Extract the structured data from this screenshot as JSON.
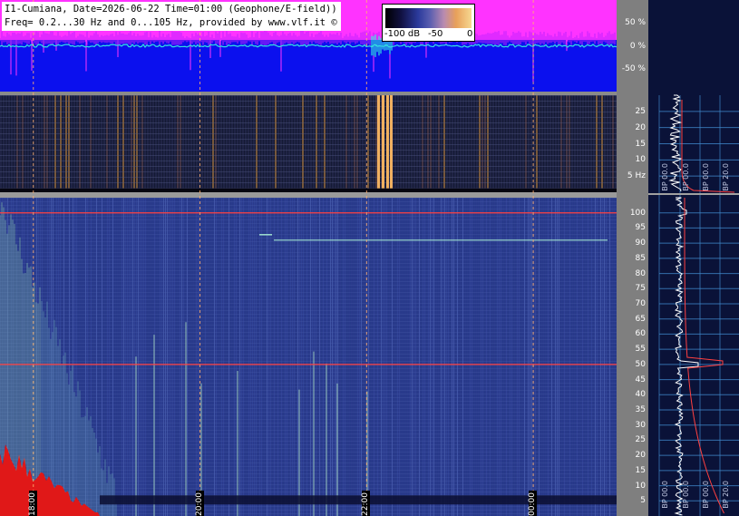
{
  "header": {
    "line1": "I1-Cumiana, Date=2026-06-22 Time=01:00 (Geophone/E-field))",
    "line2": "Freq= 0.2...30 Hz and 0...105 Hz, provided by www.vlf.it ©"
  },
  "colorbar": {
    "labels": [
      "-100 dB",
      "-50",
      "0"
    ]
  },
  "chart_data": [
    {
      "type": "line",
      "name": "seismogram-panel",
      "y_ticks": [
        "50 %",
        "0 %",
        "-50 %"
      ],
      "y_values": [
        50,
        0,
        -50
      ],
      "ylim": [
        -100,
        100
      ]
    },
    {
      "type": "heatmap",
      "name": "low-frequency-spectrogram",
      "y_ticks": [
        "25",
        "20",
        "15",
        "10",
        "5 Hz"
      ],
      "y_values": [
        25,
        20,
        15,
        10,
        5
      ],
      "ylim": [
        0,
        30
      ],
      "bright_bands_x_labels": []
    },
    {
      "type": "heatmap",
      "name": "main-spectrogram",
      "y_ticks": [
        "100",
        "95",
        "90",
        "85",
        "80",
        "75",
        "70",
        "65",
        "60",
        "55",
        "50",
        "45",
        "40",
        "35",
        "30",
        "25",
        "20",
        "15",
        "10",
        "5"
      ],
      "y_values": [
        100,
        95,
        90,
        85,
        80,
        75,
        70,
        65,
        60,
        55,
        50,
        45,
        40,
        35,
        30,
        25,
        20,
        15,
        10,
        5
      ],
      "ylim": [
        0,
        105
      ],
      "hum_lines_hz": [
        50,
        100
      ],
      "tone_line_hz": 91,
      "time_labels": [
        "18:00",
        "20:00",
        "22:00",
        "00:00"
      ],
      "time_positions_h": [
        18,
        20,
        22,
        24
      ],
      "xlim_h": [
        17.6,
        25.0
      ]
    },
    {
      "type": "line",
      "name": "side-spectrum-profile",
      "bp_labels": [
        "BP 00.0",
        "BP 00.0",
        "BP 00.0",
        "BP 20.0"
      ]
    }
  ],
  "colors": {
    "seis_bg": "#0b10ee",
    "seis_magenta": "#ff33ff",
    "trace": "#33e0e0",
    "hum_line": "#ff4040",
    "marker_line": "#ffb070",
    "grid": "#3f86c8"
  }
}
